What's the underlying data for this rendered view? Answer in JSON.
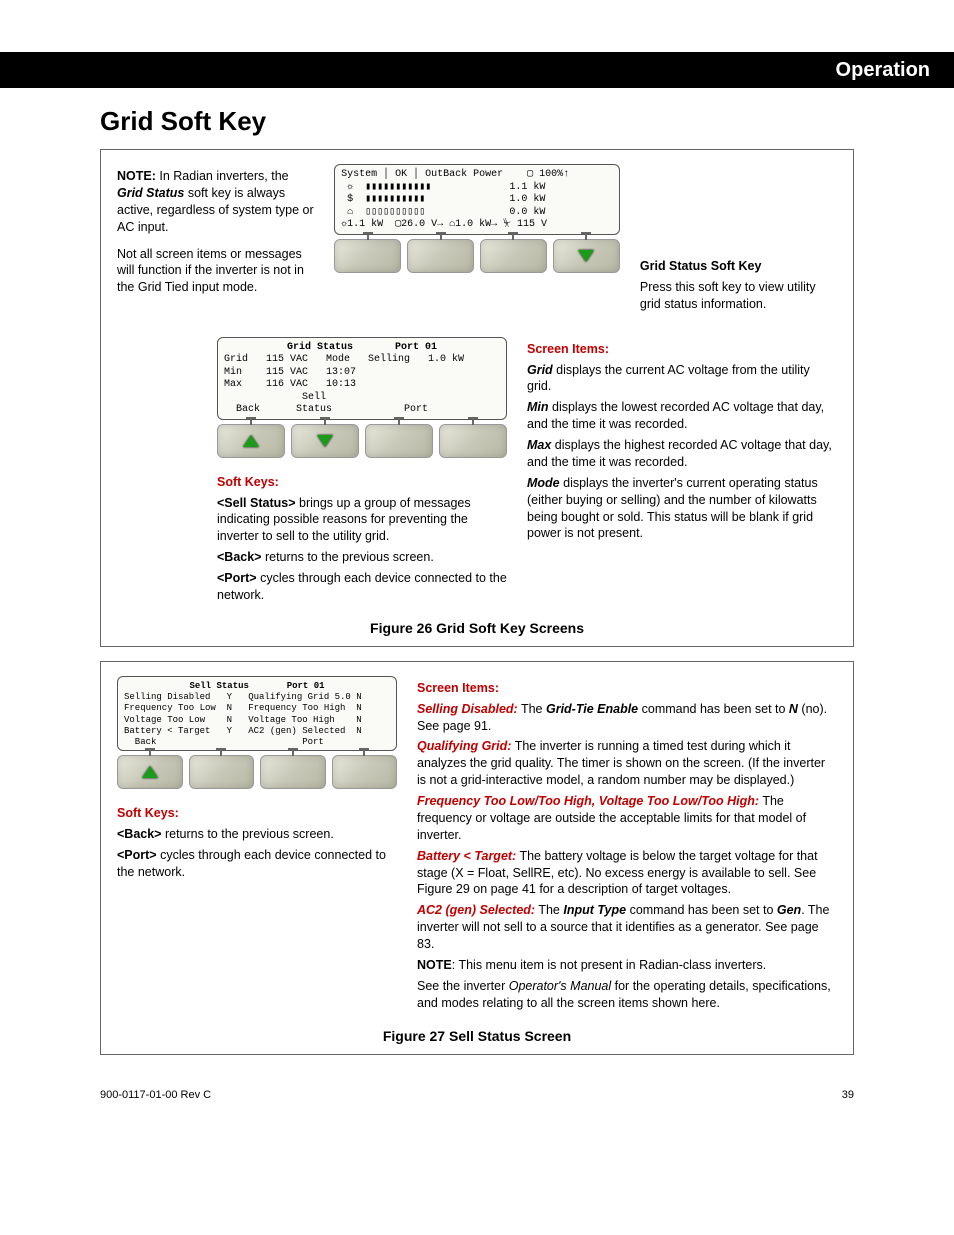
{
  "header": {
    "section": "Operation"
  },
  "title": "Grid Soft Key",
  "note1": {
    "label": "NOTE:",
    "text1": " In Radian inverters, the ",
    "emph": "Grid Status",
    "text2": " soft key is always active, regardless of system type or AC input.",
    "para2": "Not all screen items or messages will function if the inverter is not in the Grid Tied input mode."
  },
  "sys_lcd": {
    "l1": "System │ OK │ OutBack Power    ▢ 100%↑",
    "l2": " ☼  ▮▮▮▮▮▮▮▮▮▮▮             1.1 kW",
    "l3": " $  ▮▮▮▮▮▮▮▮▮▮              1.0 kW",
    "l4": " ⌂  ▯▯▯▯▯▯▯▯▯▯              0.0 kW",
    "l5": "☼1.1 kW  ▢26.0 V→ ⌂1.0 kW→ ⏧ 115 V"
  },
  "grid_side": {
    "h": "Grid  Status Soft Key",
    "p": "Press this soft key to view utility grid status information."
  },
  "grid_lcd": {
    "title": "Grid Status       Port 01",
    "r1": "Grid   115 VAC   Mode   Selling   1.0 kW",
    "r2": "Min    115 VAC   13:07",
    "r3": "Max    116 VAC   10:13",
    "r4": "             Sell",
    "r5": "  Back      Status            Port"
  },
  "grid_softkeys": {
    "h": "Soft Keys:",
    "sell_lbl": "<Sell Status>",
    "sell_txt": " brings up a group of messages indicating possible reasons for preventing the inverter to sell to the utility grid.",
    "back_lbl": "<Back>",
    "back_txt": " returns to the previous screen.",
    "port_lbl": "<Port>",
    "port_txt": " cycles through each device connected to the network."
  },
  "grid_items": {
    "h": "Screen Items:",
    "grid_l": "Grid",
    "grid_t": " displays the current AC voltage from the utility grid.",
    "min_l": "Min",
    "min_t": " displays the lowest recorded AC voltage that day, and the time it was recorded.",
    "max_l": "Max",
    "max_t": " displays the highest recorded AC voltage that day, and the time it was recorded.",
    "mode_l": "Mode",
    "mode_t": " displays the inverter's current operating status (either buying or selling) and the number of kilowatts being bought or sold.  This status will be blank if grid power is not present."
  },
  "fig26": "Figure 26      Grid Soft Key Screens",
  "sell_lcd": {
    "title": "Sell Status       Port 01",
    "r1": "Selling Disabled   Y   Qualifying Grid 5.0 N",
    "r2": "Frequency Too Low  N   Frequency Too High  N",
    "r3": "Voltage Too Low    N   Voltage Too High    N",
    "r4": "Battery < Target   Y   AC2 (gen) Selected  N",
    "r5": "  Back                           Port"
  },
  "sell_softkeys": {
    "h": "Soft Keys:",
    "back_lbl": "<Back>",
    "back_txt": " returns to the previous screen.",
    "port_lbl": "<Port>",
    "port_txt": " cycles through each device connected to the network."
  },
  "sell_items": {
    "h": "Screen Items:",
    "sd_l": "Selling Disabled:",
    "sd_t1": "  The ",
    "sd_em": "Grid-Tie Enable",
    "sd_t2": " command has been set to ",
    "sd_em2": "N",
    "sd_t3": " (no).  See page 91.",
    "qg_l": "Qualifying Grid:",
    "qg_t": "  The inverter is running a timed test during which it analyzes the grid quality.  The timer is shown on the screen.  (If the inverter is not a grid-interactive model, a random number may be displayed.)",
    "ft_l": "Frequency Too Low/Too High, Voltage Too Low/Too High:",
    "ft_t": "  The frequency or voltage are outside the acceptable limits for that model of inverter.",
    "bt_l": "Battery < Target:",
    "bt_t": "  The battery voltage is below the target voltage for that stage (X = Float, SellRE, etc).  No excess energy is available to sell.  See Figure 29 on page 41 for a description of target voltages.",
    "ac_l": "AC2 (gen) Selected:",
    "ac_t1": "  The ",
    "ac_em": "Input Type",
    "ac_t2": " command has been set to ",
    "ac_em2": "Gen",
    "ac_t3": ".  The inverter will not sell to a source that it identifies as a generator.  See page 83.",
    "note_l": "NOTE",
    "note_t": ":  This menu item is not present in Radian-class inverters.",
    "tail_t1": "See the inverter ",
    "tail_em": "Operator's Manual",
    "tail_t2": " for the operating details, specifications, and modes relating to all the screen items shown here."
  },
  "fig27": "Figure 27      Sell Status  Screen",
  "footer": {
    "left": "900-0117-01-00 Rev C",
    "right": "39"
  }
}
